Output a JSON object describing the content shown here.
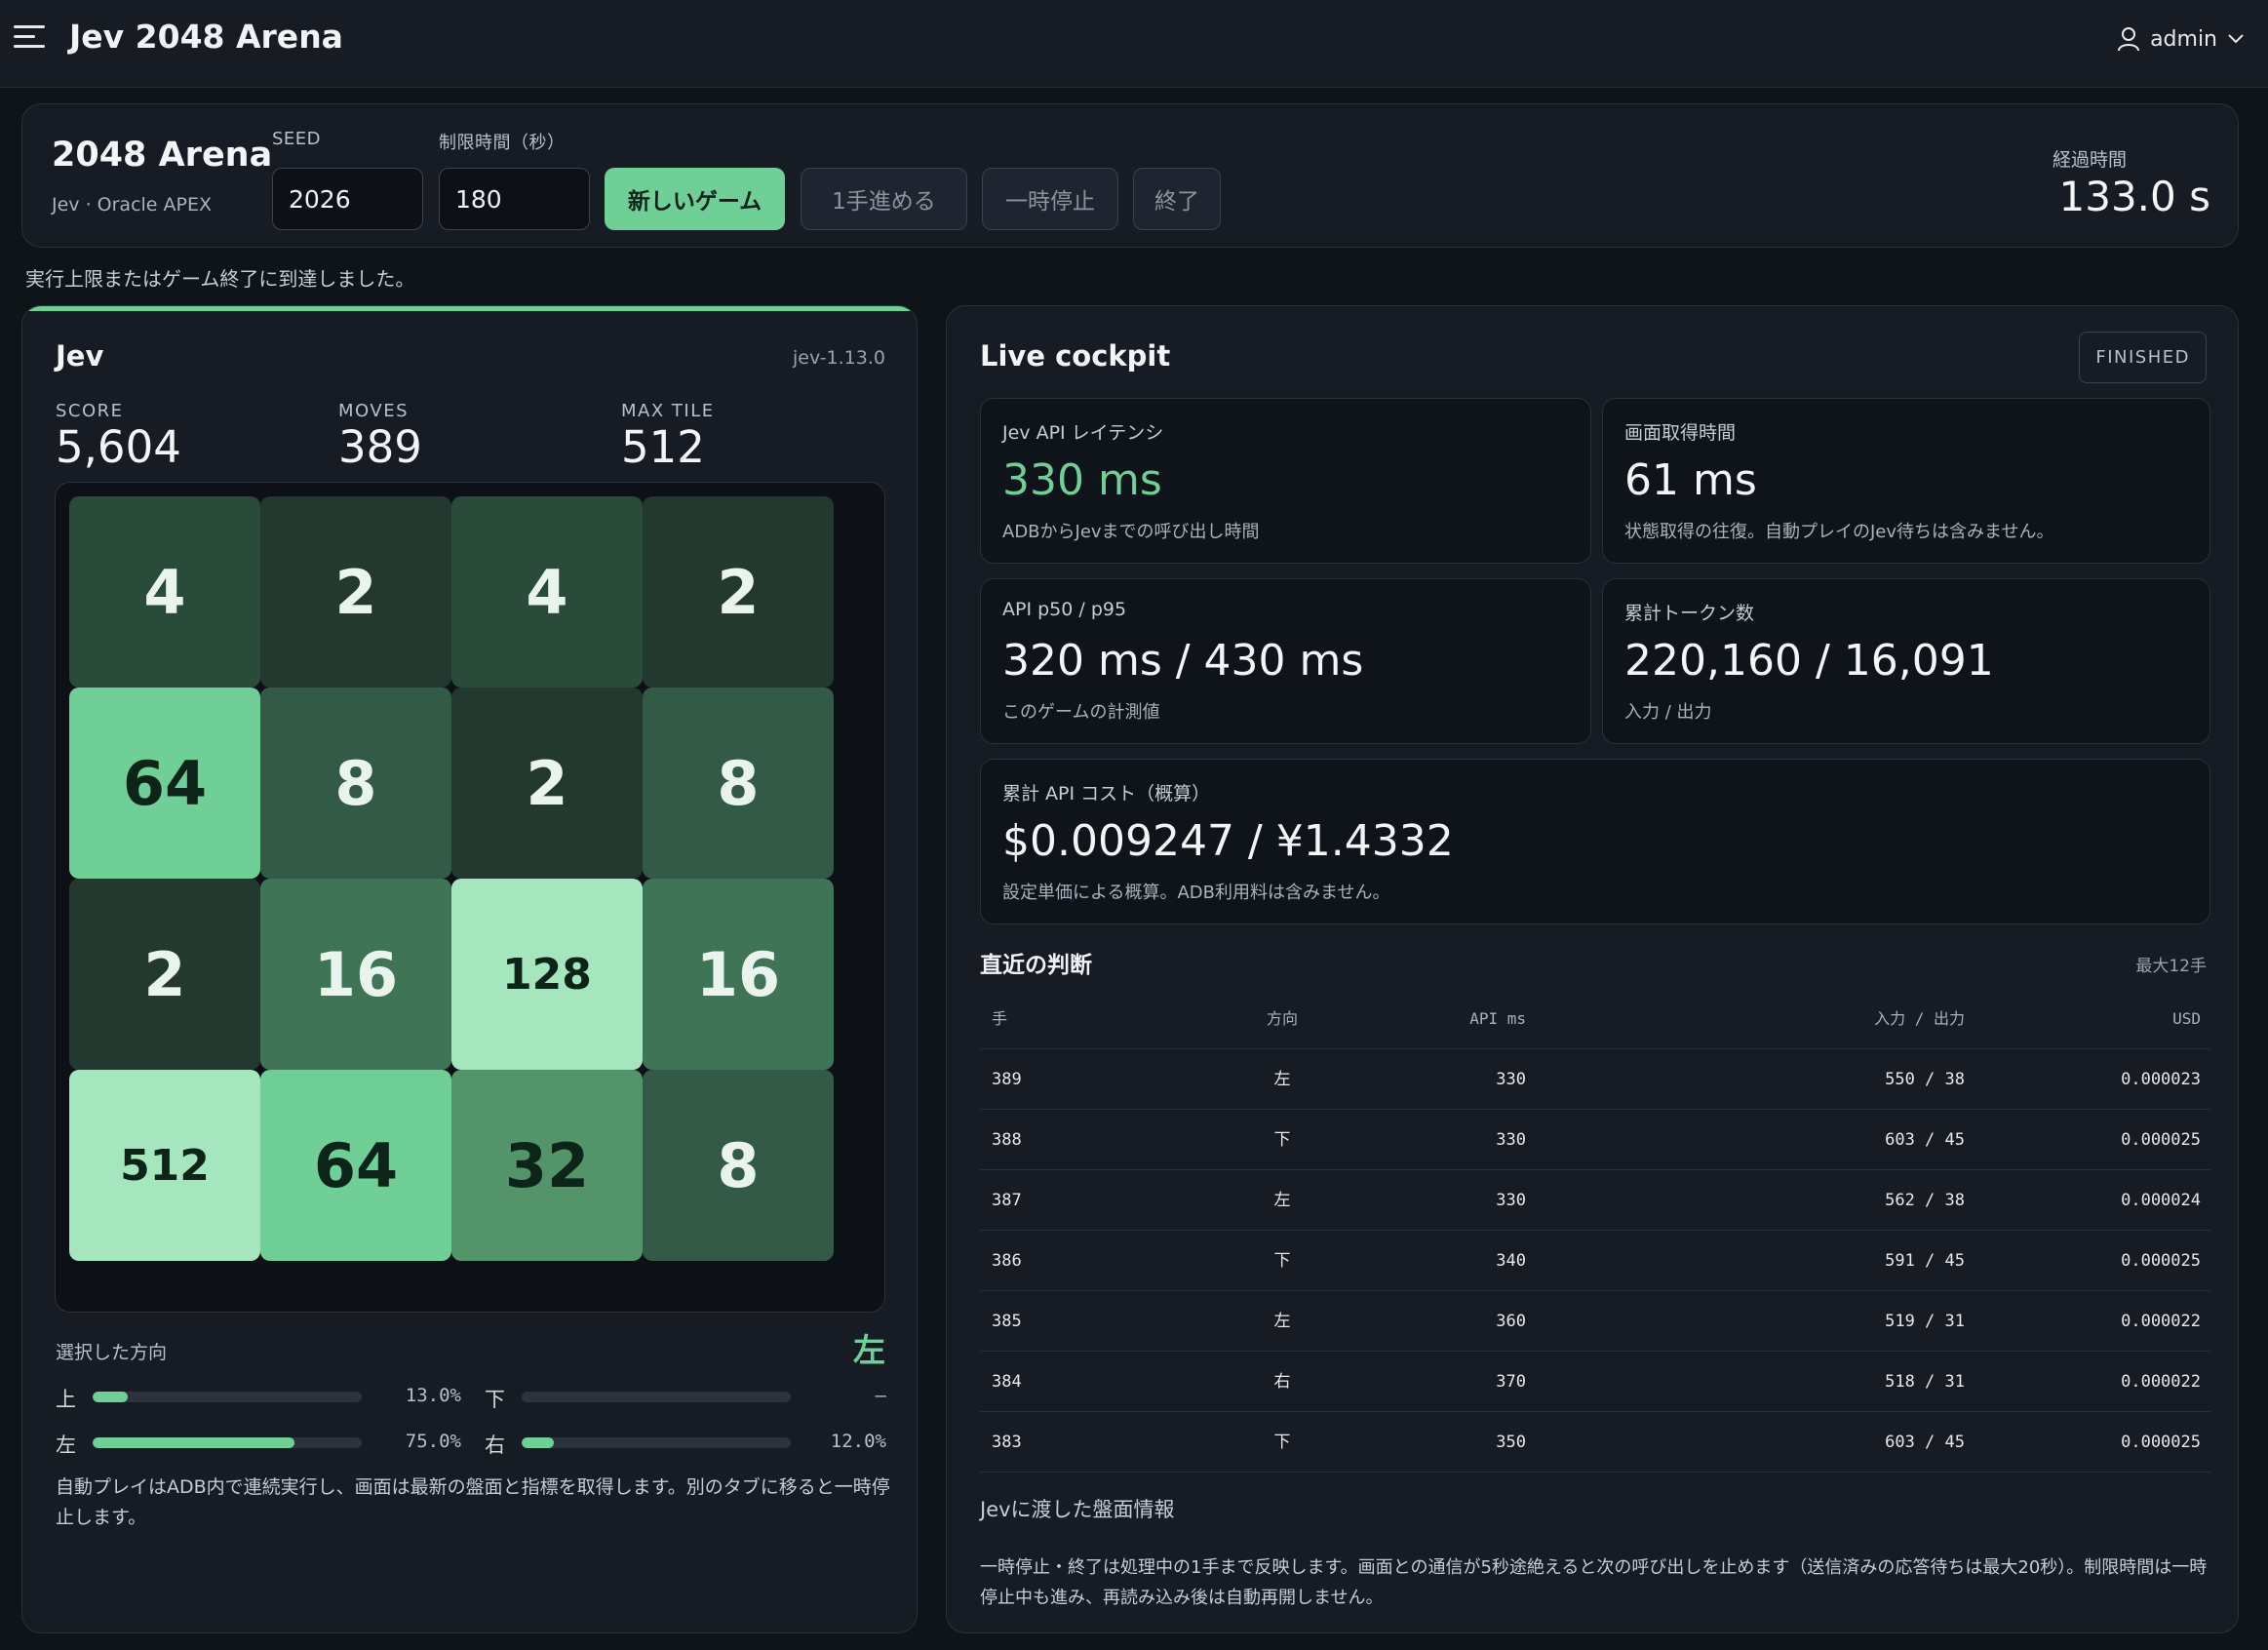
{
  "app": {
    "title": "Jev 2048 Arena",
    "user": "admin"
  },
  "control": {
    "title": "2048 Arena",
    "subtitle": "Jev · Oracle APEX",
    "seed_label": "SEED",
    "seed_value": "2026",
    "time_limit_label": "制限時間（秒）",
    "time_limit_value": "180",
    "new_game": "新しいゲーム",
    "step": "1手進める",
    "pause": "一時停止",
    "end": "終了",
    "elapsed_label": "経過時間",
    "elapsed_value": "133.0 s"
  },
  "notice": "実行上限またはゲーム終了に到達しました。",
  "board": {
    "player": "Jev",
    "version": "jev-1.13.0",
    "score_label": "SCORE",
    "score": "5,604",
    "moves_label": "MOVES",
    "moves": "389",
    "max_tile_label": "MAX TILE",
    "max_tile": "512",
    "tiles": [
      [
        "4",
        "2",
        "4",
        "2"
      ],
      [
        "64",
        "8",
        "2",
        "8"
      ],
      [
        "2",
        "16",
        "128",
        "16"
      ],
      [
        "512",
        "64",
        "32",
        "8"
      ]
    ],
    "direction_label": "選択した方向",
    "direction_selected": "左",
    "probabilities": [
      {
        "dir": "上",
        "value": 0.13,
        "text": "13.0%"
      },
      {
        "dir": "下",
        "value": 0,
        "text": "—"
      },
      {
        "dir": "左",
        "value": 0.75,
        "text": "75.0%"
      },
      {
        "dir": "右",
        "value": 0.12,
        "text": "12.0%"
      }
    ],
    "note": "自動プレイはADB内で連続実行し、画面は最新の盤面と指標を取得します。別のタブに移ると一時停止します。"
  },
  "cockpit": {
    "title": "Live cockpit",
    "status": "FINISHED",
    "metrics": [
      {
        "label": "Jev API レイテンシ",
        "value": "330 ms",
        "note": "ADBからJevまでの呼び出し時間"
      },
      {
        "label": "画面取得時間",
        "value": "61 ms",
        "note": "状態取得の往復。自動プレイのJev待ちは含みません。"
      },
      {
        "label": "API p50 / p95",
        "value": "320 ms / 430 ms",
        "note": "このゲームの計測値"
      },
      {
        "label": "累計トークン数",
        "value": "220,160 / 16,091",
        "note": "入力 / 出力"
      },
      {
        "label": "累計 API コスト（概算）",
        "value": "$0.009247 / ¥1.4332",
        "note": "設定単価による概算。ADB利用料は含みません。"
      }
    ],
    "recent_title": "直近の判断",
    "recent_hint": "最大12手",
    "columns": [
      "手",
      "方向",
      "API ms",
      "入力 / 出力",
      "USD"
    ],
    "rows": [
      [
        "389",
        "左",
        "330",
        "550 / 38",
        "0.000023"
      ],
      [
        "388",
        "下",
        "330",
        "603 / 45",
        "0.000025"
      ],
      [
        "387",
        "左",
        "330",
        "562 / 38",
        "0.000024"
      ],
      [
        "386",
        "下",
        "340",
        "591 / 45",
        "0.000025"
      ],
      [
        "385",
        "左",
        "360",
        "519 / 31",
        "0.000022"
      ],
      [
        "384",
        "右",
        "370",
        "518 / 31",
        "0.000022"
      ],
      [
        "383",
        "下",
        "350",
        "603 / 45",
        "0.000025"
      ]
    ],
    "board_info": "Jevに渡した盤面情報",
    "footer": "一時停止・終了は処理中の1手まで反映します。画面との通信が5秒途絶えると次の呼び出しを止めます（送信済みの応答待ちは最大20秒）。制限時間は一時停止中も進み、再読み込み後は自動再開しません。"
  },
  "colors": {
    "accent": "#6fcf97",
    "tile_2": "#23392f",
    "tile_4": "#2a4a3a",
    "tile_8": "#335a47",
    "tile_16": "#3f7556",
    "tile_32": "#54946a",
    "tile_64": "#6fcf97",
    "tile_128": "#a5e6bf",
    "tile_512": "#a5e6bf"
  }
}
